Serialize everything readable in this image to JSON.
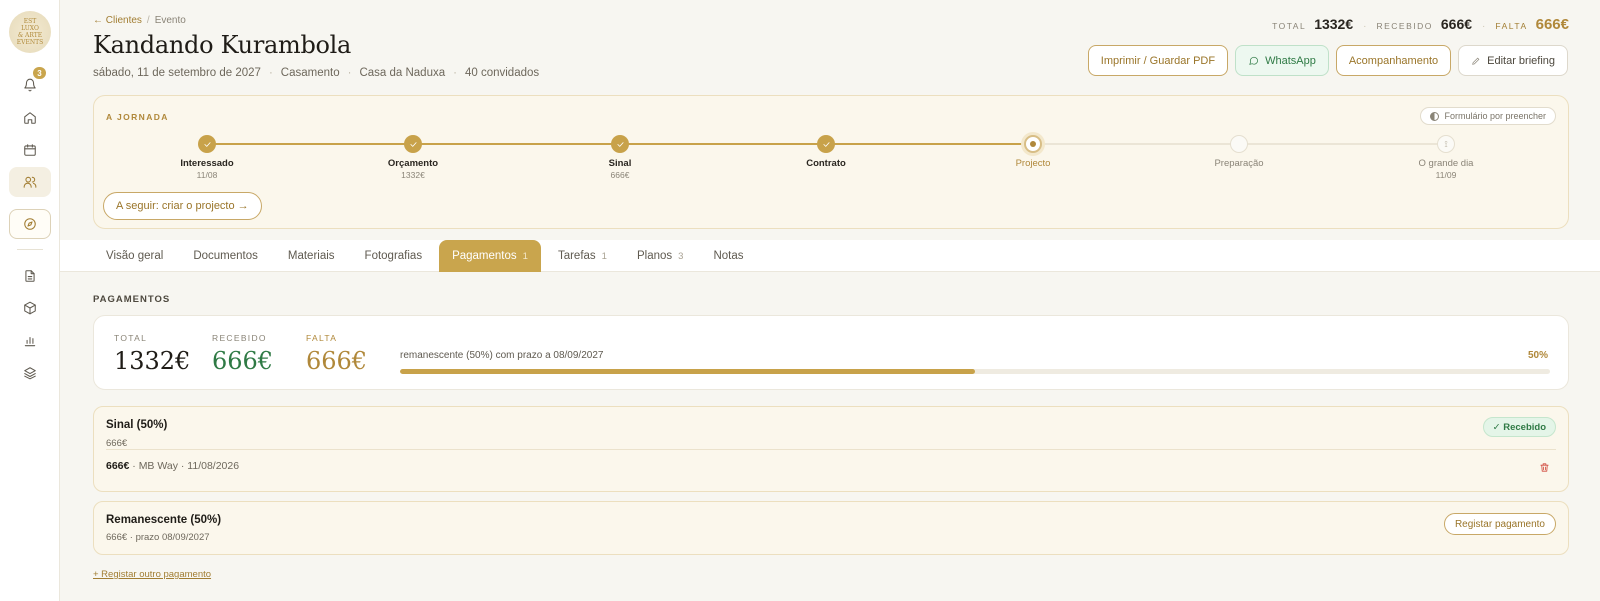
{
  "sidebar": {
    "logo_text": [
      "EST",
      "LUXO",
      "& ARTE",
      "EVENTS"
    ],
    "notification_count": "3",
    "icons": [
      "bell-icon",
      "home-icon",
      "calendar-icon",
      "users-icon",
      "compass-icon",
      "document-icon",
      "box-icon",
      "bar-chart-icon",
      "layers-icon"
    ]
  },
  "header": {
    "breadcrumb_back": "← Clientes",
    "breadcrumb_sep": "/",
    "breadcrumb_current": "Evento",
    "title": "Kandando Kurambola",
    "meta": {
      "date": "sábado, 11 de setembro de 2027",
      "type": "Casamento",
      "venue": "Casa da Naduxa",
      "guests": "40 convidados"
    },
    "totals": {
      "total_label": "TOTAL",
      "total_value": "1332€",
      "received_label": "RECEBIDO",
      "received_value": "666€",
      "missing_label": "FALTA",
      "missing_value": "666€"
    },
    "actions": {
      "print": "Imprimir / Guardar PDF",
      "whatsapp": "WhatsApp",
      "follow": "Acompanhamento",
      "edit": "Editar briefing"
    }
  },
  "journey": {
    "title": "A JORNADA",
    "form_status": "Formulário por preencher",
    "steps": [
      {
        "name": "Interessado",
        "sub": "11/08",
        "state": "done"
      },
      {
        "name": "Orçamento",
        "sub": "1332€",
        "state": "done"
      },
      {
        "name": "Sinal",
        "sub": "666€",
        "state": "done"
      },
      {
        "name": "Contrato",
        "sub": "",
        "state": "done"
      },
      {
        "name": "Projecto",
        "sub": "",
        "state": "current"
      },
      {
        "name": "Preparação",
        "sub": "",
        "state": "todo"
      },
      {
        "name": "O grande dia",
        "sub": "11/09",
        "state": "todo",
        "glyph": "⟟"
      }
    ],
    "next_action": "A seguir: criar o projecto →"
  },
  "tabs": [
    {
      "label": "Visão geral",
      "count": ""
    },
    {
      "label": "Documentos",
      "count": ""
    },
    {
      "label": "Materiais",
      "count": ""
    },
    {
      "label": "Fotografias",
      "count": ""
    },
    {
      "label": "Pagamentos",
      "count": "1",
      "active": true
    },
    {
      "label": "Tarefas",
      "count": "1"
    },
    {
      "label": "Planos",
      "count": "3"
    },
    {
      "label": "Notas",
      "count": ""
    }
  ],
  "payments": {
    "section_title": "PAGAMENTOS",
    "summary": {
      "total_label": "TOTAL",
      "total_value": "1332€",
      "received_label": "RECEBIDO",
      "received_value": "666€",
      "missing_label": "FALTA",
      "missing_value": "666€",
      "progress_text": "remanescente (50%) com prazo a 08/09/2027",
      "progress_pct": "50%",
      "progress_fraction": 0.5
    },
    "items": [
      {
        "name": "Sinal (50%)",
        "amount": "666€",
        "status": "✓ Recebido",
        "entry_amount": "666€",
        "entry_detail": " · MB Way · 11/08/2026"
      },
      {
        "name": "Remanescente (50%)",
        "detail": "666€ · prazo 08/09/2027",
        "action": "Registar pagamento"
      }
    ],
    "add_link": "+ Registar outro pagamento"
  },
  "colors": {
    "accent": "#c9a54d",
    "accent_text": "#a27e33",
    "success": "#2f7a45",
    "danger": "#d14a3e"
  }
}
